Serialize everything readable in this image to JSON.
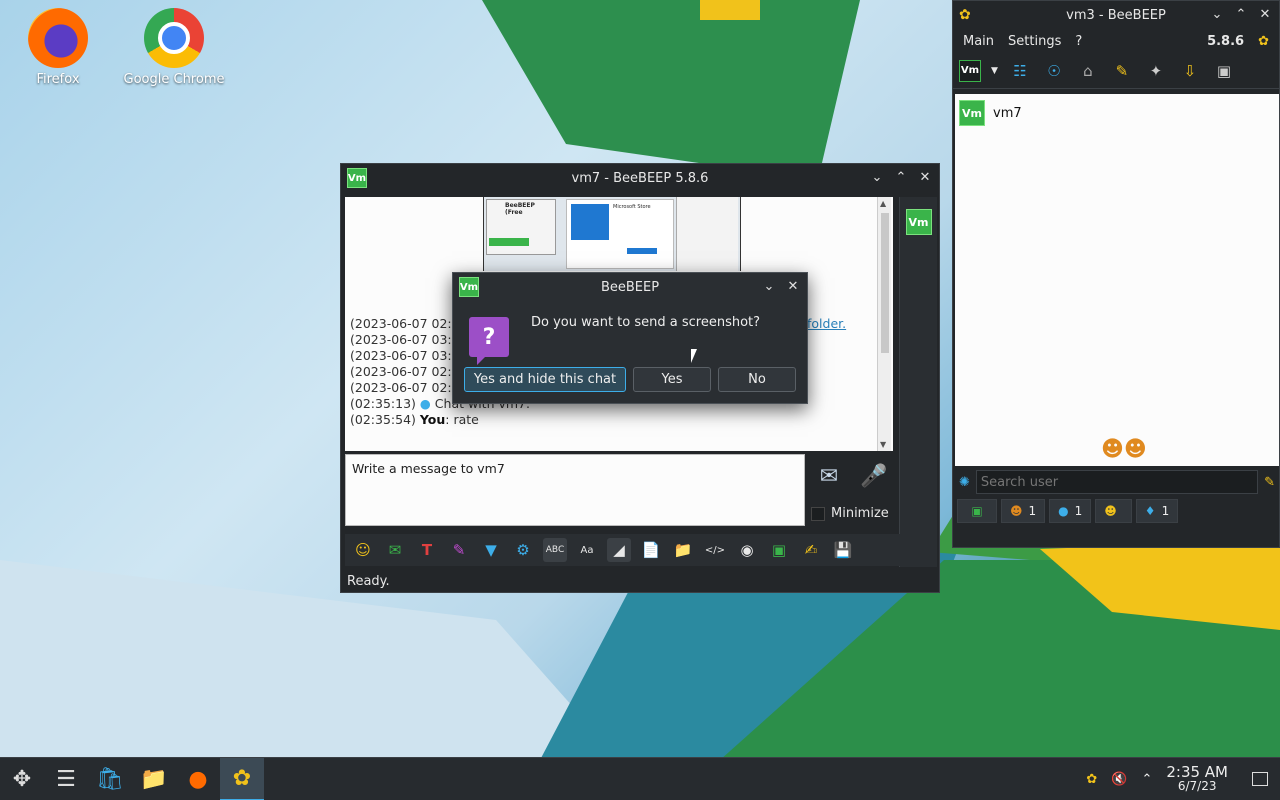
{
  "desktop": {
    "icons": [
      {
        "label": "Firefox"
      },
      {
        "label": "Google Chrome"
      }
    ]
  },
  "chat_window": {
    "title": "vm7 - BeeBEEP 5.8.6",
    "badge": "Vm",
    "log_lines": [
      {
        "text": "(2023-06-07 02:3"
      },
      {
        "text": "(2023-06-07 03:3"
      },
      {
        "text": "(2023-06-07 03:3"
      },
      {
        "text": "(2023-06-07 02:3"
      },
      {
        "text": "(2023-06-07 02:3"
      },
      {
        "time": "(02:35:13)",
        "text": "Chat with vm7."
      },
      {
        "time": "(02:35:54)",
        "sender": "You",
        "text": ": rate"
      }
    ],
    "folder_link": "folder.",
    "thumb_title": "BeeBEEP (Free",
    "thumb_store": "Microsoft Store",
    "input_placeholder": "Write a message to vm7",
    "minimize_label": "Minimize",
    "status": "Ready."
  },
  "dialog": {
    "title": "BeeBEEP",
    "badge": "Vm",
    "message": "Do you want to send a screenshot?",
    "buttons": {
      "yes_hide": "Yes and hide this chat",
      "yes": "Yes",
      "no": "No"
    }
  },
  "user_window": {
    "title": "vm3 - BeeBEEP",
    "menu": [
      "Main",
      "Settings",
      "?"
    ],
    "version": "5.8.6",
    "badge": "Vm",
    "users": [
      {
        "name": "vm7",
        "badge": "Vm"
      }
    ],
    "search_placeholder": "Search user",
    "tabs": [
      {
        "count": "1"
      },
      {
        "count": "1"
      },
      {
        "count": ""
      },
      {
        "count": "1"
      }
    ]
  },
  "taskbar": {
    "time": "2:35 AM",
    "date": "6/7/23"
  },
  "colors": {
    "accent": "#3daee9",
    "vm_green": "#3ab44a",
    "window_bg": "#232629"
  }
}
